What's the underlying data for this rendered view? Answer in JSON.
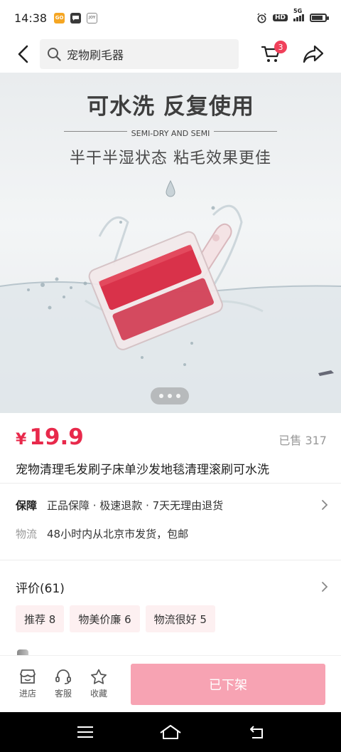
{
  "status_bar": {
    "time": "14:38",
    "app_icons": [
      {
        "name": "go-app-icon",
        "label": "GO",
        "color": "#f5a623"
      },
      {
        "name": "chat-app-icon",
        "label": "",
        "color": "#3a3a3a"
      },
      {
        "name": "joy-app-icon",
        "label": "JOY",
        "color": "#888888"
      }
    ],
    "hd_label": "HD",
    "network_label": "5G",
    "battery_level": 0.85
  },
  "top_nav": {
    "search_text": "宠物刷毛器",
    "cart_count": "3"
  },
  "product_image": {
    "title": "可水洗 反复使用",
    "subtitle_en": "SEMI-DRY AND SEMI",
    "subtitle_cn": "半干半湿状态 粘毛效果更佳",
    "carousel_count": 3
  },
  "product": {
    "currency": "¥",
    "price": "19.9",
    "sold": "已售 317",
    "title": "宠物清理毛发刷子床单沙发地毯清理滚刷可水洗"
  },
  "guarantee": {
    "label": "保障",
    "value": "正品保障 · 极速退款 · 7天无理由退货"
  },
  "shipping": {
    "label": "物流",
    "value": "48小时内从北京市发货，包邮"
  },
  "reviews": {
    "title": "评价(61)",
    "tags": [
      "推荐 8",
      "物美价廉 6",
      "物流很好 5"
    ]
  },
  "bottom_bar": {
    "store_label": "进店",
    "service_label": "客服",
    "favorite_label": "收藏",
    "action_label": "已下架"
  },
  "colors": {
    "accent": "#e8294b",
    "delisted_button": "#f7a3b3",
    "badge": "#f0405a",
    "tag_bg": "#fdf0f1"
  }
}
